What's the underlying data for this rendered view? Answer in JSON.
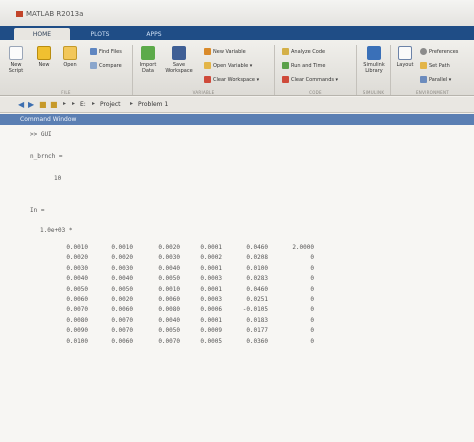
{
  "window": {
    "title": "MATLAB R2013a"
  },
  "tabs": [
    {
      "label": "HOME",
      "active": true
    },
    {
      "label": "PLOTS",
      "active": false
    },
    {
      "label": "APPS",
      "active": false
    }
  ],
  "ribbon": {
    "file": {
      "new_script": "New Script",
      "new": "New",
      "open": "Open",
      "find_files": "Find Files",
      "compare": "Compare",
      "group": "FILE"
    },
    "variable": {
      "import_data": "Import Data",
      "save_workspace": "Save Workspace",
      "new_variable": "New Variable",
      "open_variable": "Open Variable ▾",
      "clear_workspace": "Clear Workspace ▾",
      "group": "VARIABLE"
    },
    "code": {
      "analyze_code": "Analyze Code",
      "run_and_time": "Run and Time",
      "clear_commands": "Clear Commands ▾",
      "group": "CODE"
    },
    "simulink": {
      "library": "Simulink Library",
      "group": "SIMULINK"
    },
    "environment": {
      "layout": "Layout",
      "preferences": "Preferences",
      "set_path": "Set Path",
      "parallel": "Parallel ▾",
      "group": "ENVIRONMENT"
    }
  },
  "address": {
    "path": [
      "E:",
      "Project",
      "Problem 1"
    ]
  },
  "command_window": {
    "title": "Command Window",
    "prompt": ">> GUI",
    "n_brnch_label": "n_brnch =",
    "n_brnch_value": "10",
    "in_label": "In =",
    "scale": "1.0e+03 *",
    "matrix": [
      [
        "0.0010",
        "0.0010",
        "0.0020",
        "0.0001",
        "0.0460",
        "2.0000"
      ],
      [
        "0.0020",
        "0.0020",
        "0.0030",
        "0.0002",
        "0.0208",
        "0"
      ],
      [
        "0.0030",
        "0.0030",
        "0.0040",
        "0.0001",
        "0.0100",
        "0"
      ],
      [
        "0.0040",
        "0.0040",
        "0.0050",
        "0.0003",
        "0.0283",
        "0"
      ],
      [
        "0.0050",
        "0.0050",
        "0.0010",
        "0.0001",
        "0.0460",
        "0"
      ],
      [
        "0.0060",
        "0.0020",
        "0.0060",
        "0.0003",
        "0.0251",
        "0"
      ],
      [
        "0.0070",
        "0.0060",
        "0.0080",
        "0.0006",
        "-0.0105",
        "0"
      ],
      [
        "0.0080",
        "0.0070",
        "0.0040",
        "0.0001",
        "0.0183",
        "0"
      ],
      [
        "0.0090",
        "0.0070",
        "0.0050",
        "0.0009",
        "0.0177",
        "0"
      ],
      [
        "0.0100",
        "0.0060",
        "0.0070",
        "0.0005",
        "0.0360",
        "0"
      ]
    ]
  },
  "colors": {
    "tab_strip": "#1f4d86",
    "command_header": "#5b7fb3",
    "matlab_logo": "#c2442a"
  }
}
